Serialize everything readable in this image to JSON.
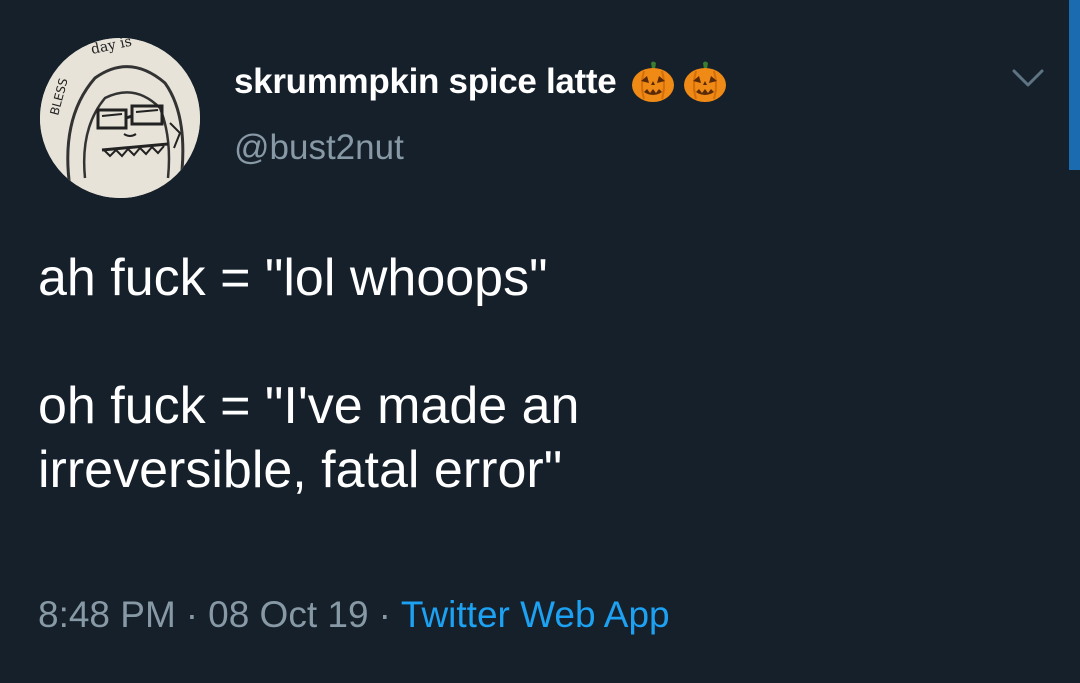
{
  "user": {
    "display_name": "skrummpkin spice latte",
    "handle": "@bust2nut",
    "name_emojis": [
      "jack-o-lantern",
      "jack-o-lantern"
    ]
  },
  "tweet": {
    "text": "ah fuck = \"lol whoops\"\n\noh fuck = \"I've made an\nirreversible, fatal error\"",
    "time": "8:48 PM",
    "separator": "·",
    "date": "08 Oct 19",
    "source": "Twitter Web App"
  },
  "icons": {
    "menu": "chevron-down-icon",
    "avatar": "sketch-face-avatar"
  },
  "colors": {
    "background": "#15202b",
    "primary_text": "#ffffff",
    "secondary_text": "#8899a6",
    "link": "#1da1f2"
  }
}
